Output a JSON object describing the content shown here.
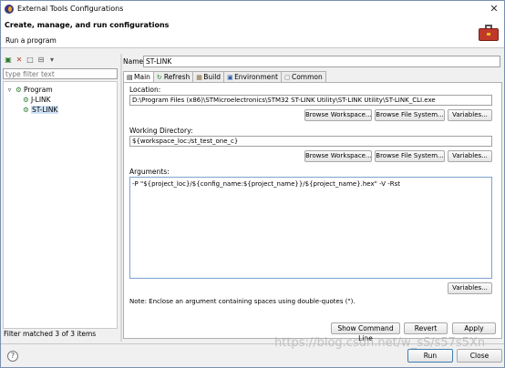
{
  "window": {
    "title": "External Tools Configurations",
    "close_glyph": "✕"
  },
  "banner": {
    "heading": "Create, manage, and run configurations",
    "subtitle": "Run a program",
    "icon": "toolbox-icon"
  },
  "left": {
    "toolbar_icons": [
      "▣",
      "✕",
      "□",
      "⊟",
      "▾"
    ],
    "filter_placeholder": "type filter text",
    "tree": {
      "root_expander": "▿",
      "root_label": "Program",
      "items": [
        {
          "label": "J-LINK",
          "selected": false
        },
        {
          "label": "ST-LINK",
          "selected": true
        }
      ]
    },
    "status": "Filter matched 3 of 3 items"
  },
  "right": {
    "name_label": "Name:",
    "name_value": "ST-LINK",
    "tabs": [
      {
        "label": "Main",
        "icon": "▤",
        "active": true
      },
      {
        "label": "Refresh",
        "icon": "↻",
        "active": false
      },
      {
        "label": "Build",
        "icon": "▦",
        "active": false
      },
      {
        "label": "Environment",
        "icon": "▣",
        "active": false
      },
      {
        "label": "Common",
        "icon": "▢",
        "active": false
      }
    ],
    "location": {
      "label": "Location:",
      "value": "D:\\Program Files (x86)\\STMicroelectronics\\STM32 ST-LINK Utility\\ST-LINK Utility\\ST-LINK_CLI.exe",
      "browse_workspace": "Browse Workspace...",
      "browse_fs": "Browse File System...",
      "variables": "Variables..."
    },
    "working_dir": {
      "label": "Working Directory:",
      "value": "${workspace_loc:/st_test_one_c}",
      "browse_workspace": "Browse Workspace...",
      "browse_fs": "Browse File System...",
      "variables": "Variables..."
    },
    "arguments": {
      "label": "Arguments:",
      "value": "-P \"${project_loc}/${config_name:${project_name}}/${project_name}.hex\" -V -Rst",
      "variables": "Variables..."
    },
    "note": "Note: Enclose an argument containing spaces using double-quotes (\").",
    "show_command_line": "Show Command Line",
    "revert": "Revert",
    "apply": "Apply"
  },
  "footer": {
    "help": "?",
    "run": "Run",
    "close": "Close"
  },
  "watermark": "https://blog.csdn.net/w_sS/s57s5Xn"
}
